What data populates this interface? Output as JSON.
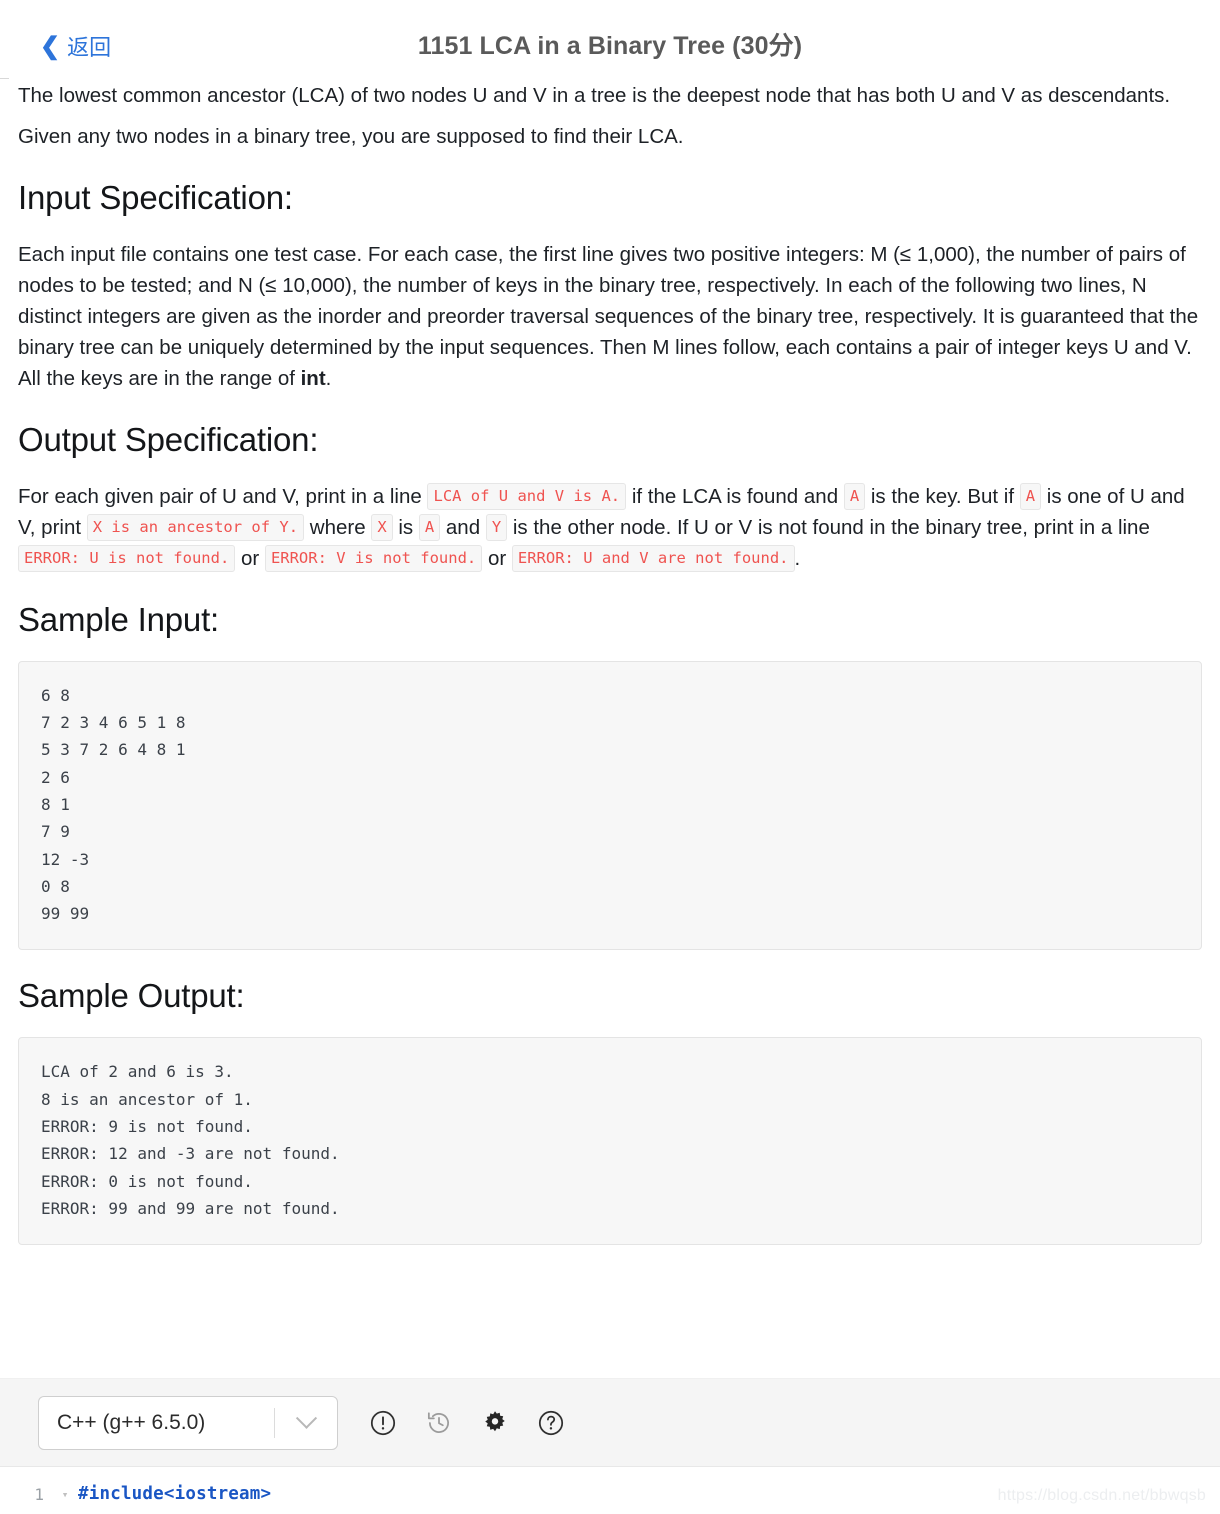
{
  "header": {
    "back_label": "返回",
    "back_icon": "chevron-left-icon",
    "title": "1151 LCA in a Binary Tree (30分)"
  },
  "problem": {
    "intro_paragraph_1": "The lowest common ancestor (LCA) of two nodes U and V in a tree is the deepest node that has both U and V as descendants.",
    "intro_paragraph_2": "Given any two nodes in a binary tree, you are supposed to find their LCA.",
    "input_spec": {
      "heading": "Input Specification:",
      "text_part_1": "Each input file contains one test case. For each case, the first line gives two positive integers: M (≤ 1,000), the number of pairs of nodes to be tested; and N (≤ 10,000), the number of keys in the binary tree, respectively. In each of the following two lines, N distinct integers are given as the inorder and preorder traversal sequences of the binary tree, respectively. It is guaranteed that the binary tree can be uniquely determined by the input sequences. Then M lines follow, each contains a pair of integer keys U and V. All the keys are in the range of ",
      "bold_term": "int",
      "text_part_2": "."
    },
    "output_spec": {
      "heading": "Output Specification:",
      "t1": "For each given pair of U and V, print in a line ",
      "code_lca": "LCA of U and V is A.",
      "t2": " if the LCA is found and ",
      "code_a1": "A",
      "t3": " is the key. But if ",
      "code_a2": "A",
      "t4": " is one of U and V, print ",
      "code_ancestor": "X is an ancestor of Y.",
      "t5": " where ",
      "code_x": "X",
      "t6": " is ",
      "code_a3": "A",
      "t7": " and ",
      "code_y": "Y",
      "t8": " is the other node. If U or V is not found in the binary tree, print in a line ",
      "code_err_u": "ERROR: U is not found.",
      "t9": " or ",
      "code_err_v": "ERROR: V is not found.",
      "t10": " or ",
      "code_err_uv": "ERROR: U and V are not found.",
      "t11": "."
    },
    "sample_input": {
      "heading": "Sample Input:",
      "lines": [
        "6 8",
        "7 2 3 4 6 5 1 8",
        "5 3 7 2 6 4 8 1",
        "2 6",
        "8 1",
        "7 9",
        "12 -3",
        "0 8",
        "99 99"
      ]
    },
    "sample_output": {
      "heading": "Sample Output:",
      "lines": [
        "LCA of 2 and 6 is 3.",
        "8 is an ancestor of 1.",
        "ERROR: 9 is not found.",
        "ERROR: 12 and -3 are not found.",
        "ERROR: 0 is not found.",
        "ERROR: 99 and 99 are not found."
      ]
    }
  },
  "editor": {
    "language_selected": "C++ (g++ 6.5.0)",
    "toolbar_icons": [
      "exclamation-circle-icon",
      "history-icon",
      "gear-icon",
      "question-circle-icon"
    ],
    "line_number": "1",
    "line_code": "#include<iostream>"
  },
  "watermark": "https://blog.csdn.net/bbwqsb",
  "colors": {
    "link_blue": "#2d74da",
    "title_gray": "#5a5a5a",
    "inline_code_red": "#ef5350",
    "code_block_bg": "#f7f7f7",
    "toolbar_bg": "#f5f5f5",
    "editor_keyword_blue": "#1a56c4"
  }
}
